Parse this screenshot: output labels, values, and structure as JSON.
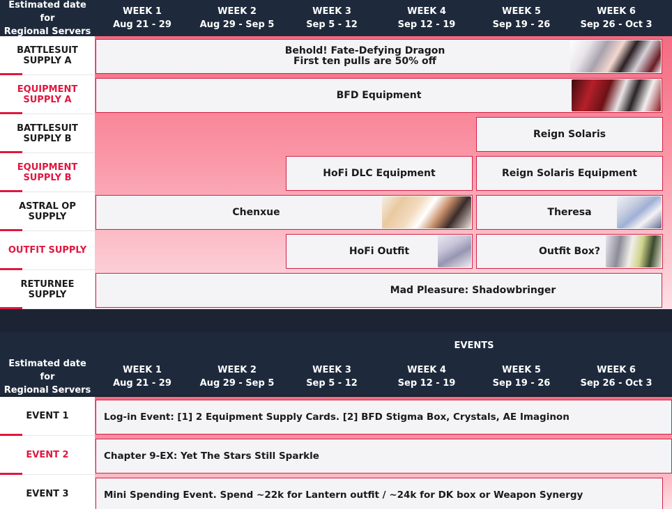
{
  "supply": {
    "header": {
      "label": [
        "Estimated date for",
        "Regional Servers"
      ],
      "weeks": [
        {
          "name": "WEEK 1",
          "dates": "Aug 21 - 29"
        },
        {
          "name": "WEEK 2",
          "dates": "Aug 29 - Sep 5"
        },
        {
          "name": "WEEK 3",
          "dates": "Sep 5 - 12"
        },
        {
          "name": "WEEK 4",
          "dates": "Sep 12 - 19"
        },
        {
          "name": "WEEK 5",
          "dates": "Sep 19 - 26"
        },
        {
          "name": "WEEK 6",
          "dates": "Sep 26 - Oct 3"
        }
      ]
    },
    "rows": [
      {
        "label": [
          "BATTLESUIT",
          "SUPPLY A"
        ],
        "color": "dark"
      },
      {
        "label": [
          "EQUIPMENT",
          "SUPPLY A"
        ],
        "color": "red"
      },
      {
        "label": [
          "BATTLESUIT",
          "SUPPLY B"
        ],
        "color": "dark"
      },
      {
        "label": [
          "EQUIPMENT",
          "SUPPLY B"
        ],
        "color": "red"
      },
      {
        "label": [
          "ASTRAL OP",
          "SUPPLY"
        ],
        "color": "dark"
      },
      {
        "label": [
          "OUTFIT SUPPLY"
        ],
        "color": "red"
      },
      {
        "label": [
          "RETURNEE",
          "SUPPLY"
        ],
        "color": "dark"
      }
    ],
    "banners": [
      {
        "id": "bfd",
        "lines": [
          "Behold! Fate-Defying Dragon",
          "First ten pulls are 50% off"
        ],
        "icon": "character-art-bfd"
      },
      {
        "id": "bfd-equip",
        "lines": [
          "BFD Equipment"
        ],
        "icon": "equipment-art-bfd"
      },
      {
        "id": "reign",
        "lines": [
          "Reign Solaris"
        ]
      },
      {
        "id": "hofi-dlc",
        "lines": [
          "HoFi DLC Equipment"
        ]
      },
      {
        "id": "reign-equip",
        "lines": [
          "Reign Solaris Equipment"
        ]
      },
      {
        "id": "chenxue",
        "lines": [
          "Chenxue"
        ],
        "icon": "character-art-chenxue"
      },
      {
        "id": "theresa",
        "lines": [
          "Theresa"
        ],
        "icon": "character-art-theresa"
      },
      {
        "id": "hofi-outfit",
        "lines": [
          "HoFi Outfit"
        ],
        "icon": "outfit-art-hofi"
      },
      {
        "id": "outfit-box",
        "lines": [
          "Outfit Box?"
        ],
        "icon": "outfit-art-box"
      },
      {
        "id": "mad-pleasure",
        "lines": [
          "Mad Pleasure: Shadowbringer"
        ]
      }
    ]
  },
  "events": {
    "title": "EVENTS",
    "header": {
      "label": [
        "Estimated date for",
        "Regional Servers"
      ],
      "weeks": [
        {
          "name": "WEEK 1",
          "dates": "Aug 21 - 29"
        },
        {
          "name": "WEEK 2",
          "dates": "Aug 29 - Sep 5"
        },
        {
          "name": "WEEK 3",
          "dates": "Sep 5 - 12"
        },
        {
          "name": "WEEK 4",
          "dates": "Sep 12 - 19"
        },
        {
          "name": "WEEK 5",
          "dates": "Sep 19 - 26"
        },
        {
          "name": "WEEK 6",
          "dates": "Sep 26 - Oct 3"
        }
      ]
    },
    "rows": [
      {
        "label": "EVENT 1",
        "color": "dark",
        "text": "Log-in Event: [1] 2 Equipment Supply Cards. [2] BFD Stigma Box, Crystals, AE Imaginon"
      },
      {
        "label": "EVENT 2",
        "color": "red",
        "text": "Chapter 9-EX: Yet The Stars Still Sparkle"
      },
      {
        "label": "EVENT 3",
        "color": "dark",
        "text": "Mini Spending Event. Spend ~22k for Lantern outfit / ~24k for DK box or Weapon Synergy"
      }
    ]
  },
  "colors": {
    "header_bg": "#1e2a3c",
    "accent": "#e0173f",
    "box_border": "#d41f46",
    "box_bg": "#f4f4f6"
  }
}
